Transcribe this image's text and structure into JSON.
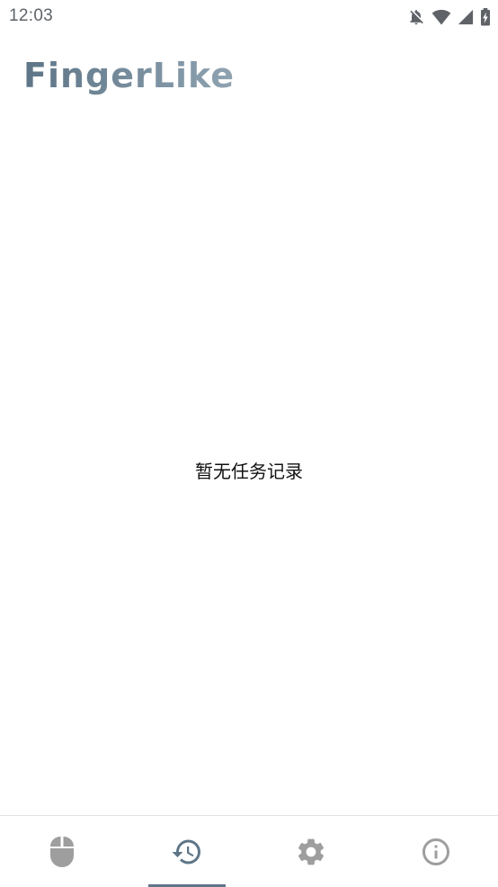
{
  "status_bar": {
    "time": "12:03",
    "icons": [
      "notifications-off-icon",
      "wifi-icon",
      "cellular-signal-icon",
      "battery-charging-icon"
    ]
  },
  "header": {
    "app_title": "FingerLike"
  },
  "main": {
    "empty_message": "暂无任务记录"
  },
  "bottom_nav": {
    "active_index": 1,
    "active_color": "#5d7587",
    "inactive_color": "#9e9e9e",
    "items": [
      {
        "icon": "mouse-icon"
      },
      {
        "icon": "history-icon"
      },
      {
        "icon": "settings-icon"
      },
      {
        "icon": "info-icon"
      }
    ]
  }
}
